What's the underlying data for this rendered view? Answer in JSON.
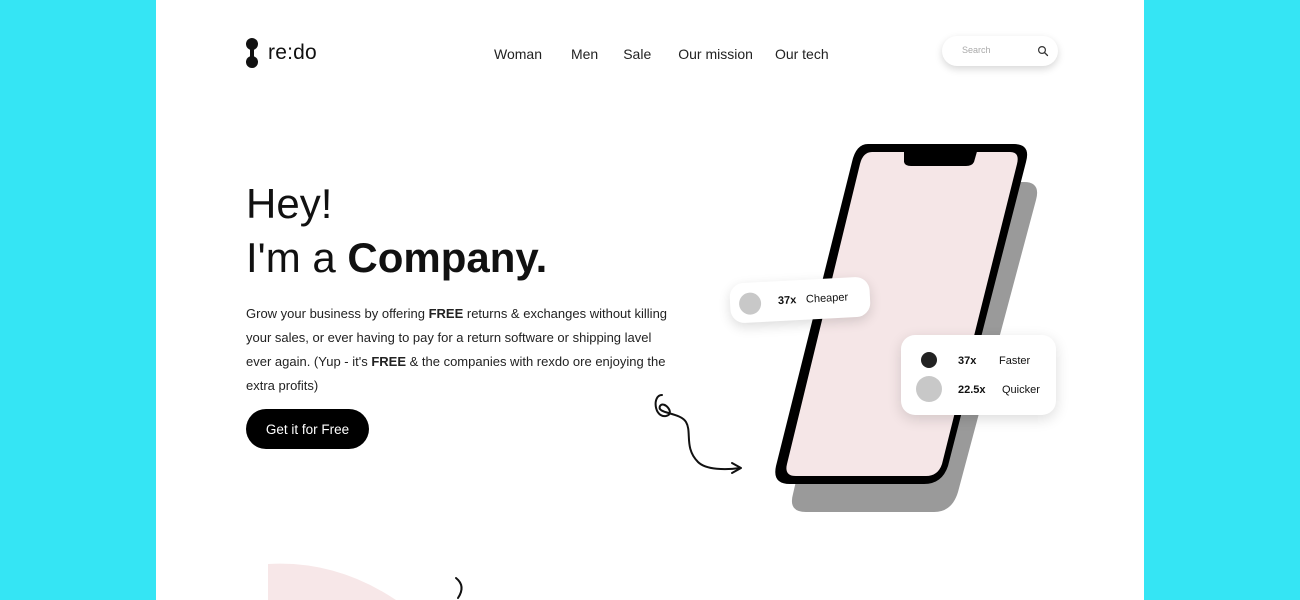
{
  "brand": {
    "name": "re:do"
  },
  "nav": {
    "items": [
      "Woman",
      "Men",
      "Sale",
      "Our mission",
      "Our tech"
    ]
  },
  "search": {
    "placeholder": "Search",
    "icon": "search-icon"
  },
  "hero": {
    "line1": "Hey!",
    "line2_prefix": "I'm a ",
    "line2_bold": "Company.",
    "description": {
      "p1": "Grow your business by offering ",
      "b1": "FREE",
      "p2": " returns & exchanges without killing your sales, or ever having to pay for a return software or shipping lavel ever again. (Yup - it's ",
      "b2": "FREE",
      "p3": " & the companies with rexdo ore enjoying the extra profits)"
    },
    "cta": "Get it for Free"
  },
  "stats": {
    "card1": {
      "value": "37x",
      "label": "Cheaper"
    },
    "card2": [
      {
        "value": "37x",
        "label": "Faster"
      },
      {
        "value": "22.5x",
        "label": "Quicker"
      }
    ]
  },
  "colors": {
    "page_bg": "#35e5f4",
    "content_bg": "#ffffff",
    "button": "#000000",
    "phone_screen": "#f5e6e7",
    "phone_shadow": "#9a9a9a",
    "accent_gray": "#c8c8c8",
    "accent_dark": "#222222"
  }
}
